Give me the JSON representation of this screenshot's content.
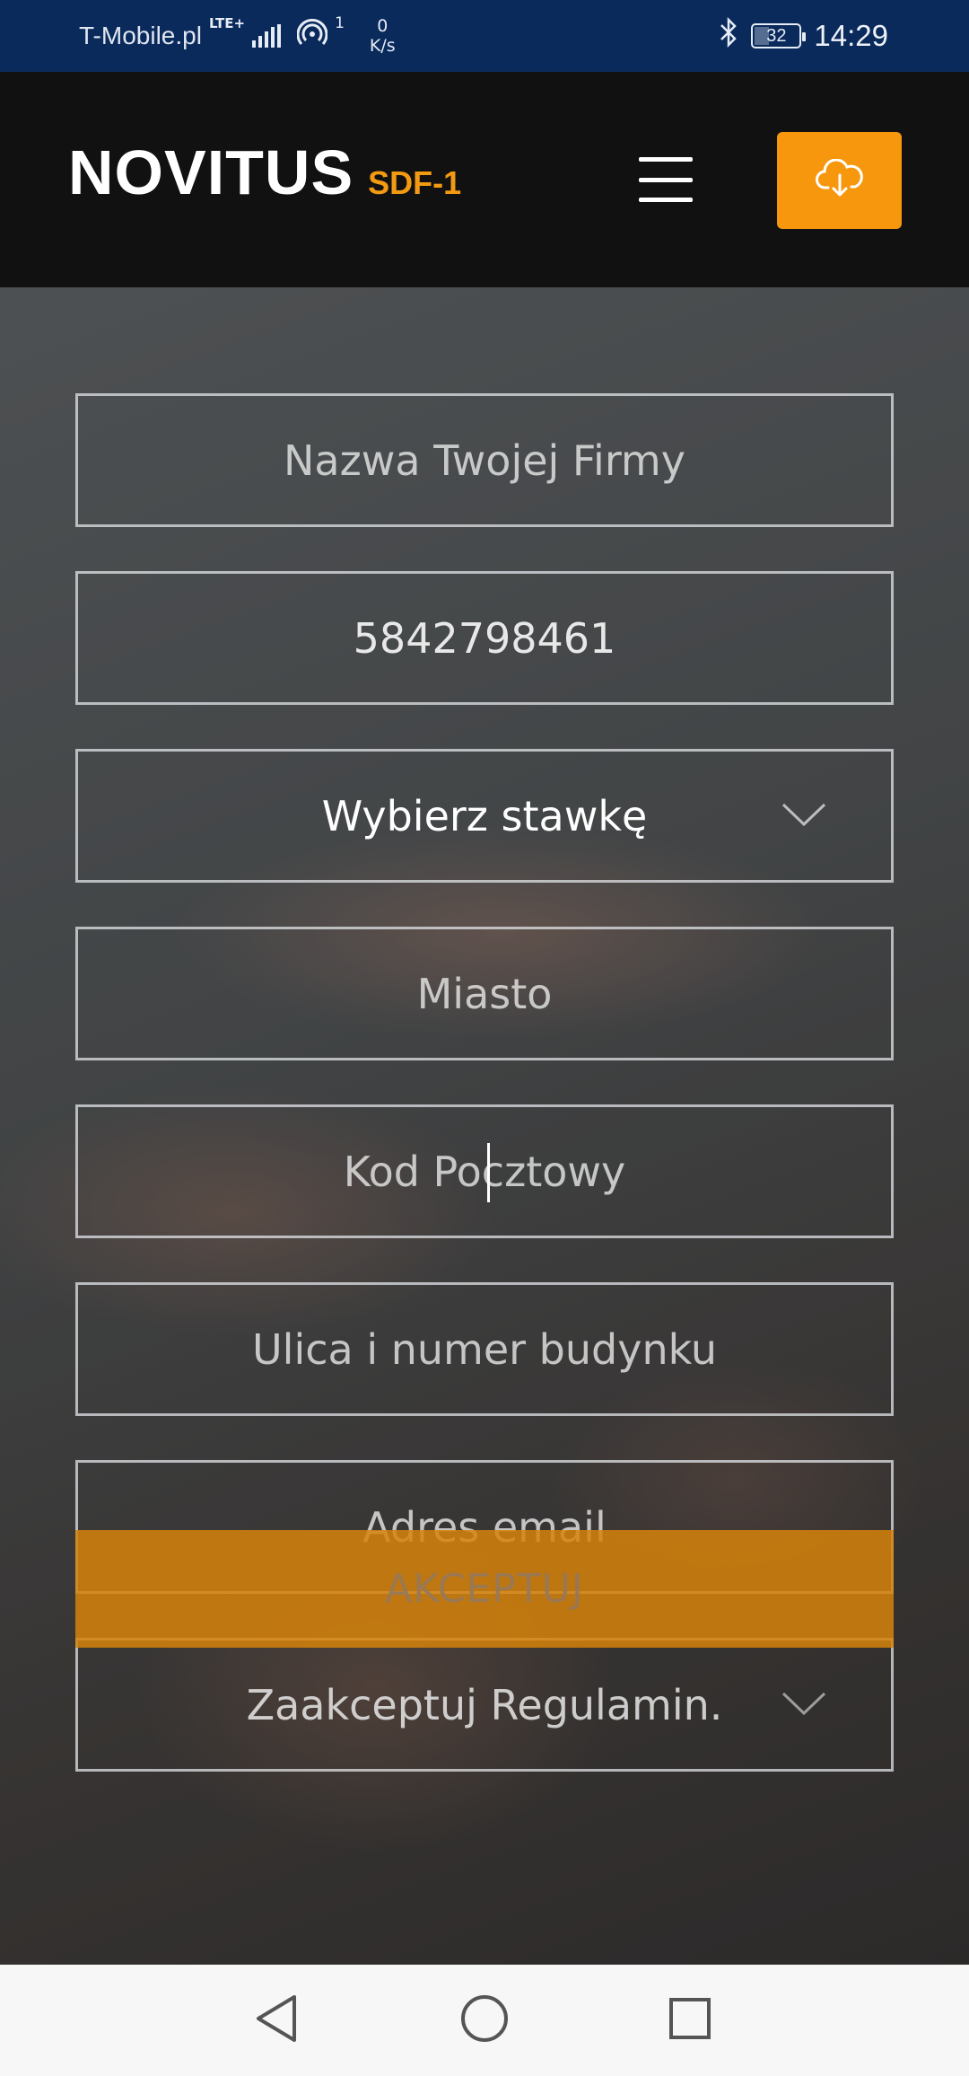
{
  "status_bar": {
    "carrier": "T-Mobile.pl",
    "network_type": "LTE+",
    "hotspot_count": "1",
    "net_speed_value": "0",
    "net_speed_unit": "K/s",
    "battery_level": "32",
    "time": "14:29"
  },
  "header": {
    "logo_main": "NOVITUS",
    "logo_sub": "SDF-1",
    "menu_icon": "hamburger-menu-icon",
    "download_icon": "cloud-download-icon",
    "accent_color": "#f7970d"
  },
  "form": {
    "company_name": {
      "placeholder": "Nazwa Twojej Firmy",
      "value": ""
    },
    "tax_id": {
      "placeholder": "",
      "value": "5842798461"
    },
    "rate_select": {
      "selected": "Wybierz stawkę"
    },
    "city": {
      "placeholder": "Miasto",
      "value": ""
    },
    "postal_code": {
      "placeholder": "Kod Pocztowy",
      "value": ""
    },
    "street": {
      "placeholder": "Ulica i numer budynku",
      "value": ""
    },
    "email": {
      "placeholder": "Adres email",
      "value": ""
    },
    "terms_select": {
      "selected": "Zaakceptuj Regulamin."
    },
    "submit_label": "AKCEPTUJ"
  },
  "nav_bar": {
    "back_icon": "back-triangle-icon",
    "home_icon": "home-circle-icon",
    "recents_icon": "recents-square-icon"
  }
}
